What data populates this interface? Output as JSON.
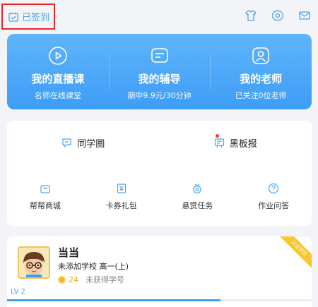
{
  "header": {
    "checkin_label": "已签到",
    "icons": [
      "shirt-icon",
      "gear-icon",
      "mail-icon"
    ]
  },
  "services": [
    {
      "icon": "live-tv-icon",
      "title": "我的直播课",
      "subtitle": "名师在线课堂"
    },
    {
      "icon": "tutoring-icon",
      "title": "我的辅导",
      "subtitle": "期中9.9元/30分钟"
    },
    {
      "icon": "teacher-icon",
      "title": "我的老师",
      "subtitle": "已关注0位老师"
    }
  ],
  "features": [
    {
      "icon": "chat-icon",
      "label": "同学圈"
    },
    {
      "icon": "blackboard-icon",
      "label": "黑板报",
      "has_dot": true
    }
  ],
  "tools": [
    {
      "icon": "bag-icon",
      "label": "帮帮商城"
    },
    {
      "icon": "coupon-icon",
      "label": "卡券礼包"
    },
    {
      "icon": "reward-icon",
      "label": "悬赏任务"
    },
    {
      "icon": "question-icon",
      "label": "作业问答"
    }
  ],
  "profile": {
    "name": "当当",
    "school": "未添加学校 高一(上)",
    "coins": "24",
    "student_id": "未获得学号",
    "level": "LV 2",
    "ribbon": "认证学员",
    "progress": 0.7
  },
  "colors": {
    "accent": "#3d9df6",
    "highlight_border": "#e8262b",
    "coin": "#f7b52c"
  }
}
